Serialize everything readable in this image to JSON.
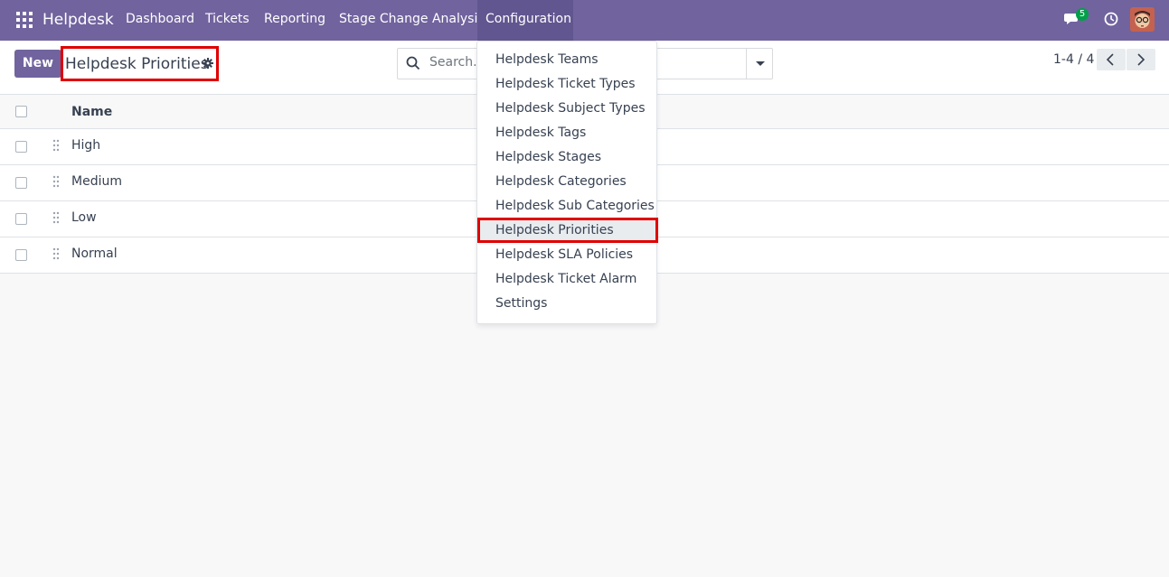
{
  "navbar": {
    "brand": "Helpdesk",
    "menu": [
      "Dashboard",
      "Tickets",
      "Reporting",
      "Stage Change Analysis"
    ],
    "active_menu": "Configuration",
    "chat_count": "5"
  },
  "control": {
    "new_label": "New",
    "breadcrumb": "Helpdesk Priorities",
    "search_placeholder": "Search...",
    "pager": "1-4 / 4"
  },
  "table": {
    "header": "Name",
    "rows": [
      "High",
      "Medium",
      "Low",
      "Normal"
    ]
  },
  "dropdown": {
    "items": [
      "Helpdesk Teams",
      "Helpdesk Ticket Types",
      "Helpdesk Subject Types",
      "Helpdesk Tags",
      "Helpdesk Stages",
      "Helpdesk Categories",
      "Helpdesk Sub Categories",
      "Helpdesk Priorities",
      "Helpdesk SLA Policies",
      "Helpdesk Ticket Alarm",
      "Settings"
    ]
  },
  "colors": {
    "brand": "#71639e",
    "highlight": "#e00000",
    "badge": "#00a049"
  }
}
